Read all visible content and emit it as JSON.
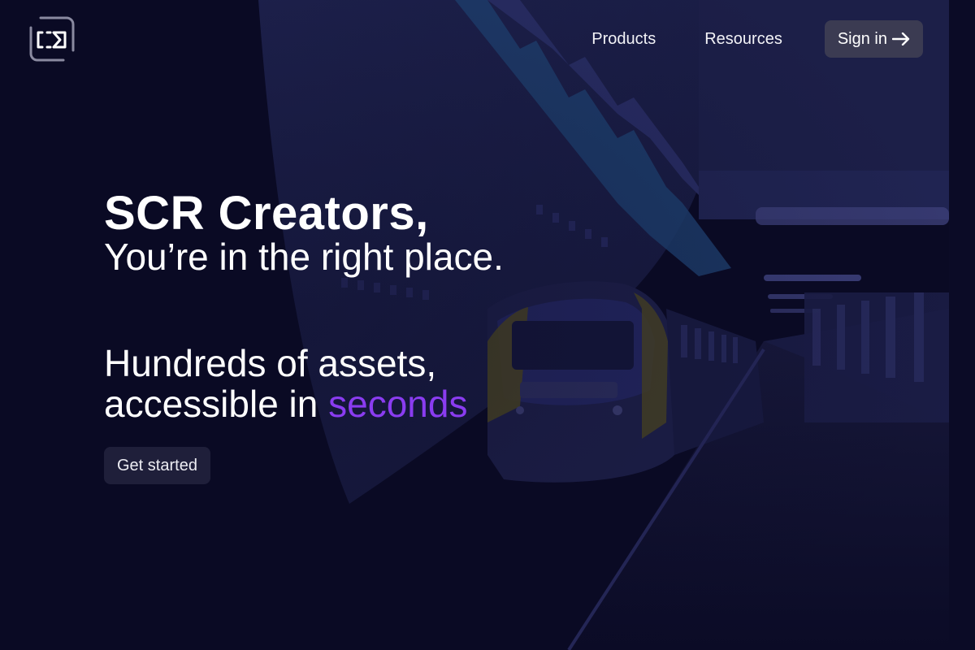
{
  "nav": {
    "logo_icon": "camera-frame-logo-icon",
    "products_label": "Products",
    "resources_label": "Resources",
    "signin_label": "Sign in",
    "signin_icon": "arrow-right-icon"
  },
  "hero": {
    "headline": "SCR Creators,",
    "tagline": "You’re in the right place.",
    "sub_line1": "Hundreds of assets,",
    "sub_line2_prefix": "accessible in ",
    "sub_line2_accent": "seconds",
    "cta_label": "Get started"
  },
  "colors": {
    "background": "#0a0a24",
    "accent": "#8a3cf0",
    "signin_button": "#3b3b52",
    "cta_button": "#1f1f3a"
  },
  "background": {
    "image_subject": "dimmed train station platform illustration"
  }
}
